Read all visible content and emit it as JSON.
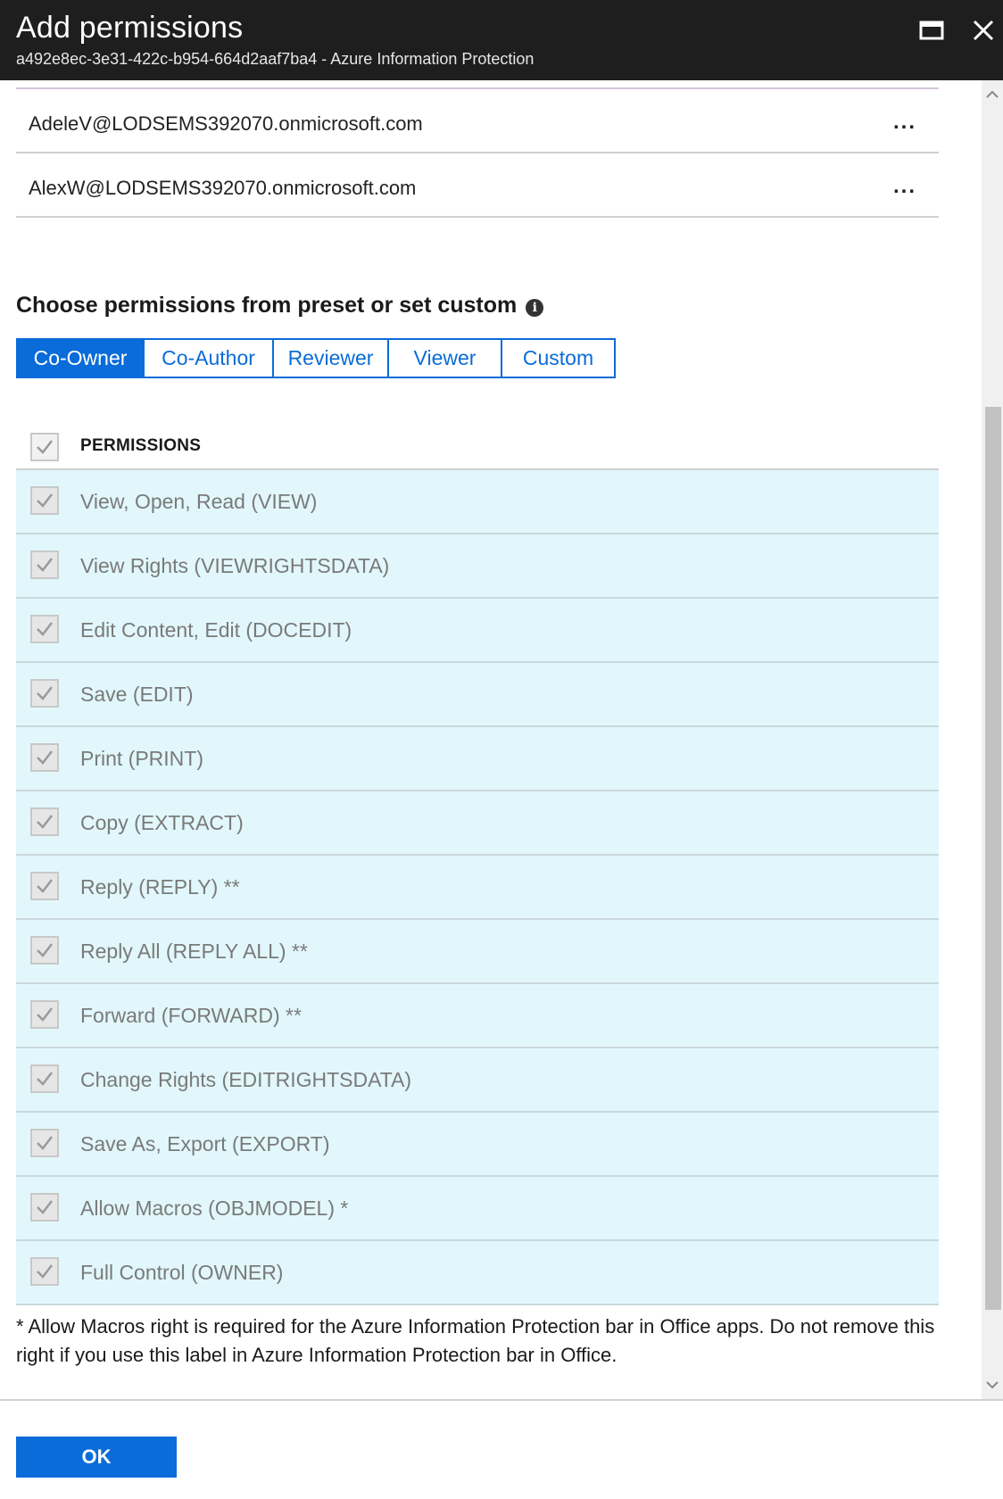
{
  "window": {
    "title": "Add permissions",
    "subtitle": "a492e8ec-3e31-422c-b954-664d2aaf7ba4 - Azure Information Protection"
  },
  "users": [
    {
      "email": "AdeleV@LODSEMS392070.onmicrosoft.com",
      "more": "..."
    },
    {
      "email": "AlexW@LODSEMS392070.onmicrosoft.com",
      "more": "..."
    }
  ],
  "permissions_section": {
    "title": "Choose permissions from preset or set custom",
    "info_icon": "i",
    "tabs": [
      {
        "label": "Co-Owner",
        "active": true
      },
      {
        "label": "Co-Author",
        "active": false
      },
      {
        "label": "Reviewer",
        "active": false
      },
      {
        "label": "Viewer",
        "active": false
      },
      {
        "label": "Custom",
        "active": false
      }
    ],
    "header_label": "PERMISSIONS",
    "header_checked": true,
    "items": [
      {
        "label": "View, Open, Read (VIEW)",
        "checked": true
      },
      {
        "label": "View Rights (VIEWRIGHTSDATA)",
        "checked": true
      },
      {
        "label": "Edit Content, Edit (DOCEDIT)",
        "checked": true
      },
      {
        "label": "Save (EDIT)",
        "checked": true
      },
      {
        "label": "Print (PRINT)",
        "checked": true
      },
      {
        "label": "Copy (EXTRACT)",
        "checked": true
      },
      {
        "label": "Reply (REPLY) **",
        "checked": true
      },
      {
        "label": "Reply All (REPLY ALL) **",
        "checked": true
      },
      {
        "label": "Forward (FORWARD) **",
        "checked": true
      },
      {
        "label": "Change Rights (EDITRIGHTSDATA)",
        "checked": true
      },
      {
        "label": "Save As, Export (EXPORT)",
        "checked": true
      },
      {
        "label": "Allow Macros (OBJMODEL) *",
        "checked": true
      },
      {
        "label": "Full Control (OWNER)",
        "checked": true
      }
    ],
    "footnote": "* Allow Macros right is required for the Azure Information Protection bar in Office apps. Do not remove this right if you use this label in Azure Information Protection bar in Office."
  },
  "footer": {
    "ok_label": "OK"
  },
  "colors": {
    "accent": "#0a6cd8",
    "row_bg": "#e1f7fb",
    "titlebar": "#1e1e1e"
  }
}
